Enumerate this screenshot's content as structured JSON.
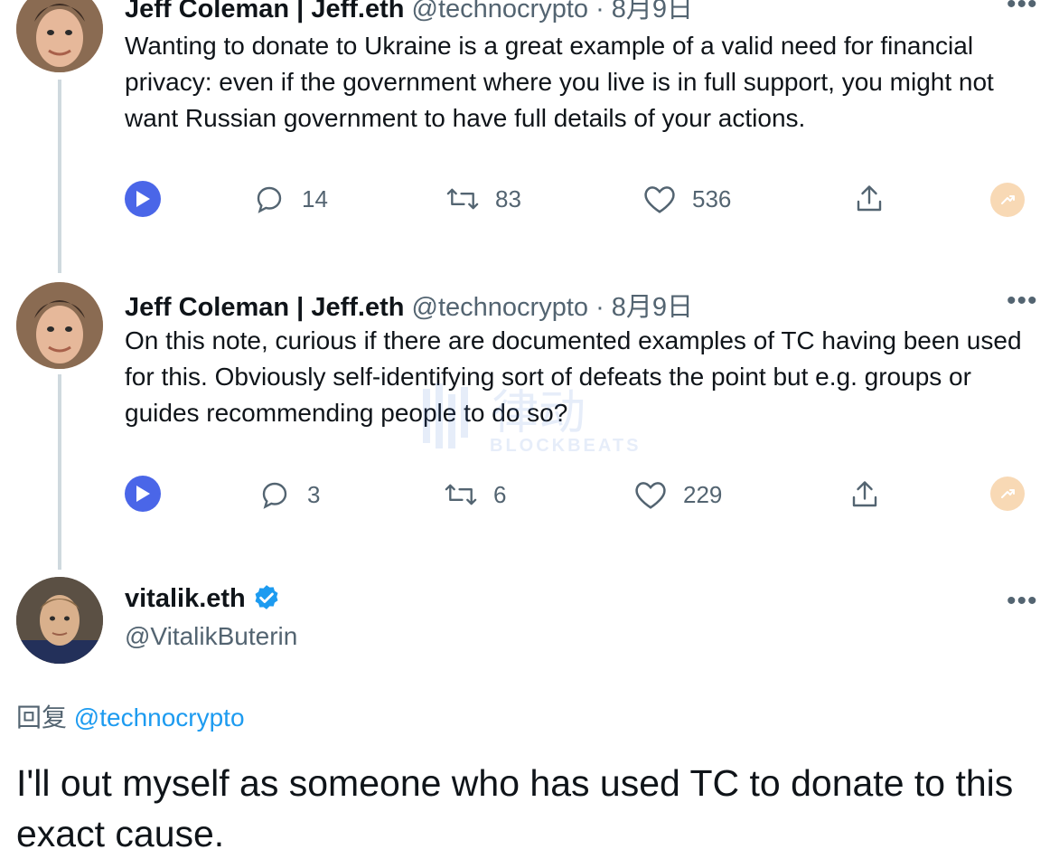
{
  "tweets": [
    {
      "author_name": "Jeff Coleman | Jeff.eth",
      "handle": "@technocrypto",
      "separator": " · ",
      "date": "8月9日",
      "text": "Wanting to donate to Ukraine is a great example of a valid need for financial privacy: even if the government where you live is in full support, you might not want Russian government to have full details of your actions.",
      "replies": "14",
      "retweets": "83",
      "likes": "536"
    },
    {
      "author_name": "Jeff Coleman | Jeff.eth",
      "handle": "@technocrypto",
      "separator": " · ",
      "date": "8月9日",
      "text": "On this note, curious if there are documented examples of TC having been used for this. Obviously self-identifying sort of defeats the point but e.g. groups or guides recommending people to do so?",
      "replies": "3",
      "retweets": "6",
      "likes": "229"
    }
  ],
  "main_tweet": {
    "author_name": "vitalik.eth",
    "handle": "@VitalikButerin",
    "reply_prefix": "回复",
    "reply_to": "@technocrypto",
    "text": "I'll out myself as someone who has used TC to donate to this exact cause."
  },
  "more_label": "•••",
  "watermark": {
    "logo_text": "律动",
    "sub_text": "BLOCKBEATS"
  },
  "colors": {
    "accent": "#1d9bf0",
    "play": "#4a66e8",
    "tip": "#f8d9b5",
    "muted": "#536471",
    "thread": "#cfd9de"
  },
  "icons": [
    "play-icon",
    "reply-icon",
    "retweet-icon",
    "like-icon",
    "share-icon",
    "tip-icon",
    "verified-icon",
    "more-icon"
  ]
}
